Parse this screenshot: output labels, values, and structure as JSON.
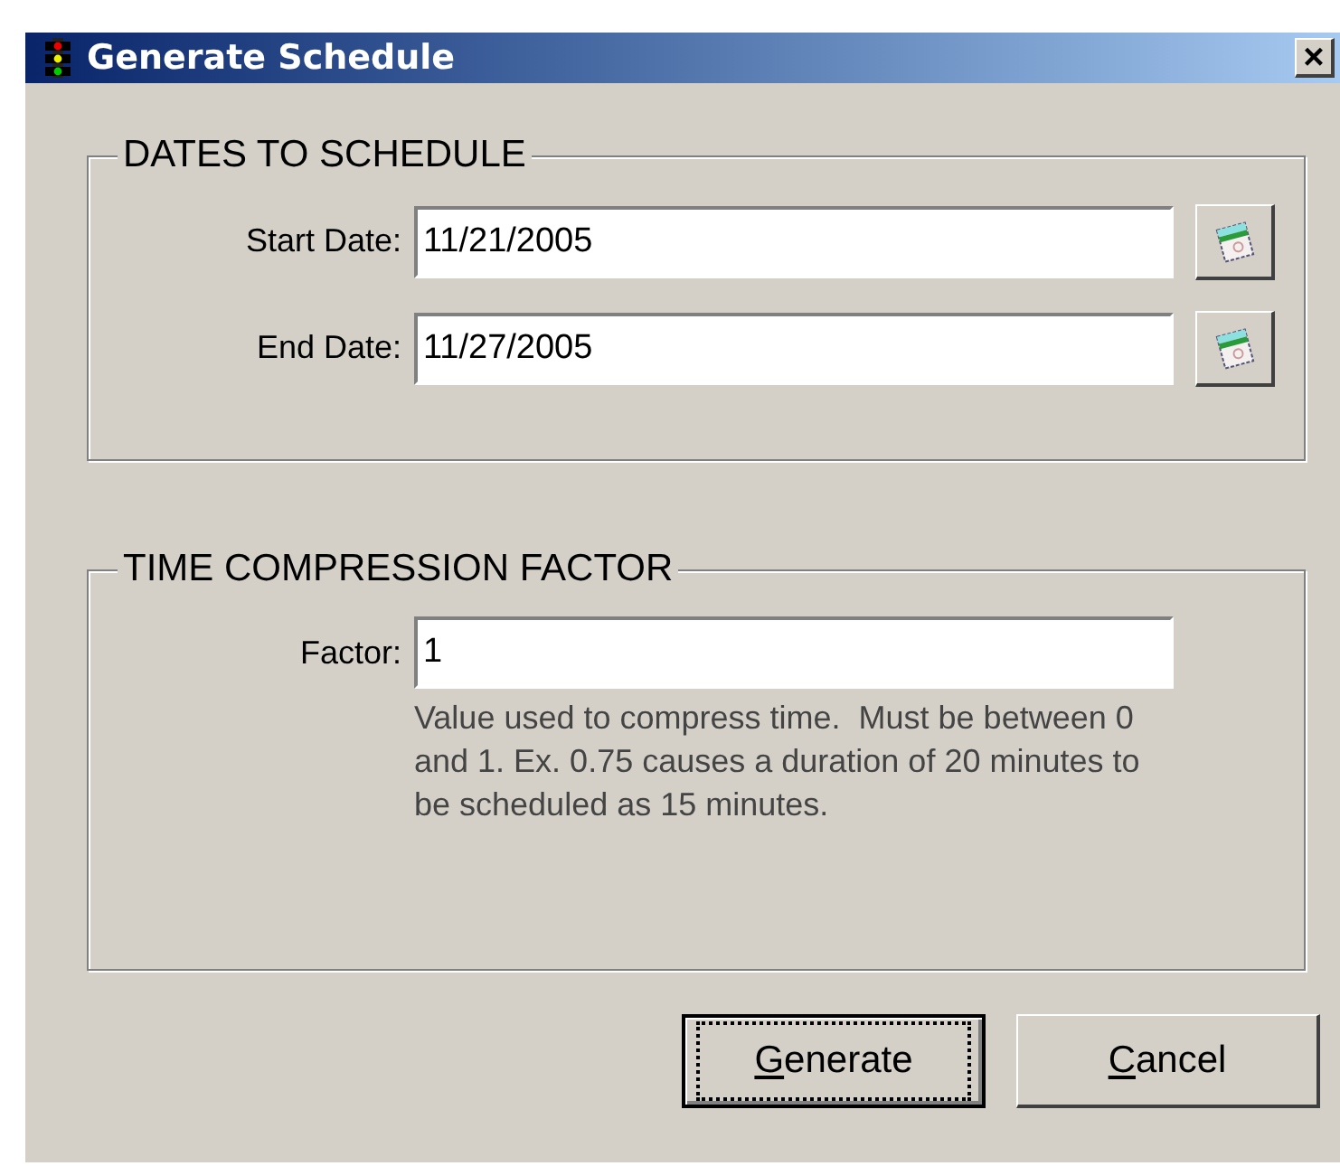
{
  "window": {
    "title": "Generate Schedule",
    "close": "×"
  },
  "groups": [
    {
      "title": "DATES TO SCHEDULE",
      "fields": [
        {
          "label": "Start Date:",
          "value": "11/21/2005",
          "kind": "date"
        },
        {
          "label": "End Date:",
          "value": "11/27/2005",
          "kind": "date"
        }
      ]
    },
    {
      "title": "TIME COMPRESSION FACTOR",
      "fields": [
        {
          "label": "Factor:",
          "value": "1",
          "kind": "text",
          "hint": "Value used to compress time.  Must be between 0 and 1. Ex. 0.75 causes a duration of 20 minutes to be scheduled as 15 minutes."
        }
      ]
    }
  ],
  "buttons": [
    {
      "label": "Generate",
      "default": true,
      "access_key_underlined": true
    },
    {
      "label": "Cancel",
      "default": false,
      "access_key_underlined": true
    }
  ]
}
